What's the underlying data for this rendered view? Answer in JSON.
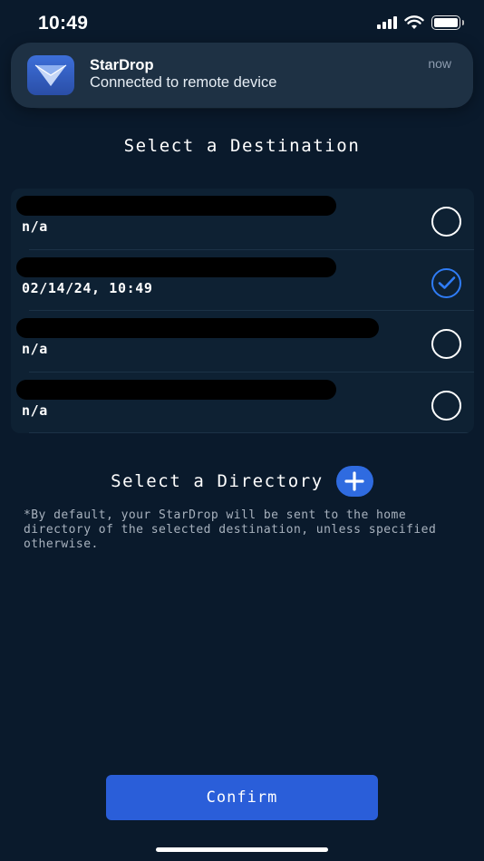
{
  "status_bar": {
    "time": "10:49"
  },
  "notification": {
    "app_name": "StarDrop",
    "message": "Connected to remote device",
    "time": "now"
  },
  "destination": {
    "title": "Select a Destination",
    "items": [
      {
        "subtitle": "n/a",
        "selected": false
      },
      {
        "subtitle": "02/14/24, 10:49",
        "selected": true
      },
      {
        "subtitle": "n/a",
        "selected": false
      },
      {
        "subtitle": "n/a",
        "selected": false
      }
    ]
  },
  "directory": {
    "title": "Select a Directory",
    "note": "*By default, your StarDrop will be sent to the home directory of the selected destination, unless specified otherwise."
  },
  "confirm_label": "Confirm",
  "colors": {
    "background": "#0a1a2c",
    "accent": "#2f7cf6",
    "button": "#2a5ed9"
  }
}
